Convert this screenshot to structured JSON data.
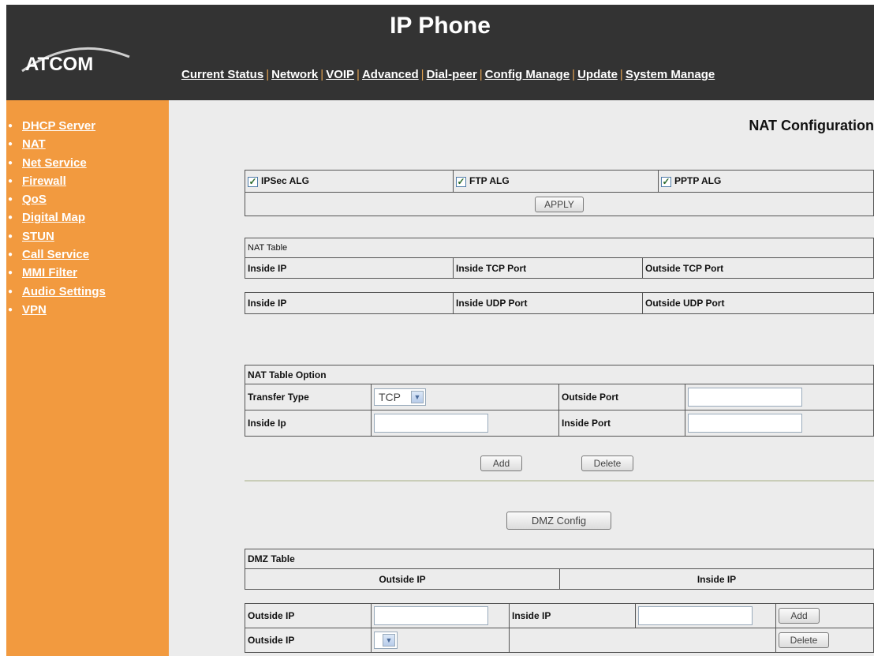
{
  "header": {
    "title": "IP Phone",
    "logo_text": "ATCOM",
    "nav": [
      {
        "label": "Current Status"
      },
      {
        "label": "Network"
      },
      {
        "label": "VOIP"
      },
      {
        "label": "Advanced"
      },
      {
        "label": "Dial-peer"
      },
      {
        "label": "Config Manage"
      },
      {
        "label": "Update"
      },
      {
        "label": "System Manage"
      }
    ]
  },
  "sidebar": {
    "items": [
      {
        "label": "DHCP Server"
      },
      {
        "label": "NAT"
      },
      {
        "label": "Net Service"
      },
      {
        "label": "Firewall"
      },
      {
        "label": "QoS"
      },
      {
        "label": "Digital Map"
      },
      {
        "label": "STUN"
      },
      {
        "label": "Call Service"
      },
      {
        "label": "MMI Filter"
      },
      {
        "label": "Audio Settings"
      },
      {
        "label": "VPN"
      }
    ]
  },
  "page": {
    "title": "NAT Configuration"
  },
  "alg": {
    "ipsec_label": "IPSec ALG",
    "ipsec_checked": true,
    "ftp_label": "FTP ALG",
    "ftp_checked": true,
    "pptp_label": "PPTP ALG",
    "pptp_checked": true,
    "apply_label": "APPLY"
  },
  "nat_table": {
    "caption": "NAT Table",
    "tcp_headers": [
      "Inside IP",
      "Inside TCP Port",
      "Outside TCP Port"
    ],
    "udp_headers": [
      "Inside IP",
      "Inside UDP Port",
      "Outside UDP Port"
    ]
  },
  "nat_option": {
    "caption": "NAT Table Option",
    "transfer_type_label": "Transfer Type",
    "transfer_type_value": "TCP",
    "outside_port_label": "Outside Port",
    "outside_port_value": "",
    "inside_ip_label": "Inside Ip",
    "inside_ip_value": "",
    "inside_port_label": "Inside Port",
    "inside_port_value": "",
    "add_label": "Add",
    "delete_label": "Delete"
  },
  "dmz": {
    "config_label": "DMZ Config",
    "caption": "DMZ Table",
    "headers": [
      "Outside IP",
      "Inside IP"
    ],
    "form": {
      "outside_ip_label": "Outside IP",
      "outside_ip_value": "",
      "inside_ip_label": "Inside IP",
      "inside_ip_value": "",
      "add_label": "Add",
      "outside_ip_label_2": "Outside IP",
      "outside_ip_select_value": "",
      "delete_label": "Delete"
    }
  },
  "colors": {
    "header_bg": "#333333",
    "sidebar_bg": "#f29a3f",
    "content_bg": "#ececec"
  }
}
